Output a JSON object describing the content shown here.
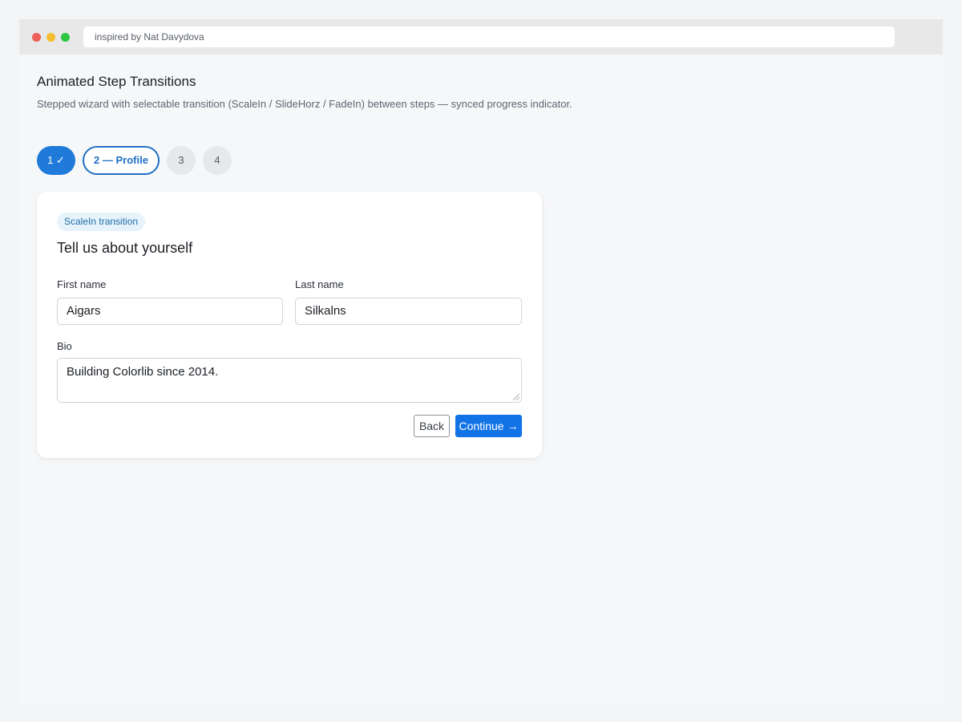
{
  "browser": {
    "url_text": "inspired by Nat Davydova"
  },
  "page": {
    "title": "Animated Step Transitions",
    "subtitle": "Stepped wizard with selectable transition (ScaleIn / SlideHorz / FadeIn) between steps — synced progress indicator."
  },
  "steps": [
    {
      "label": "1 ✓",
      "state": "done"
    },
    {
      "label": "2 — Profile",
      "state": "active"
    },
    {
      "label": "3",
      "state": "todo"
    },
    {
      "label": "4",
      "state": "todo"
    }
  ],
  "card": {
    "badge": "ScaleIn transition",
    "title": "Tell us about yourself",
    "first_name": {
      "label": "First name",
      "value": "Aigars"
    },
    "last_name": {
      "label": "Last name",
      "value": "Silkalns"
    },
    "bio": {
      "label": "Bio",
      "value": "Building Colorlib since 2014."
    },
    "back_label": "Back",
    "continue_label": "Continue →"
  },
  "colors": {
    "accent": "#1273e6",
    "step_done": "#1f7ad9",
    "badge_bg": "#e7f3fb"
  }
}
